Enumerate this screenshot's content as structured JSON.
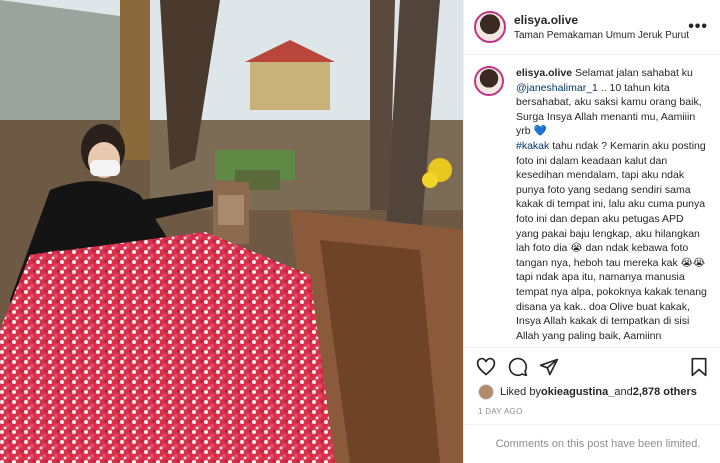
{
  "post": {
    "username": "elisya.olive",
    "location": "Taman Pemakaman Umum Jeruk Purut",
    "caption": {
      "username": "elisya.olive",
      "p1": " Selamat jalan sahabat ku ",
      "mention": "@janeshalimar_1",
      "p2": " .. 10 tahun kita bersahabat, aku saksi kamu orang baik, Surga Insya Allah menanti mu, Aamiiin yrb 💙\n",
      "hashtag": "#kakak",
      "p3": " tahu ndak ? Kemarin aku posting foto ini dalam keadaan kalut dan kesedihan mendalam, tapi aku ndak punya foto yang sedang sendiri sama kakak di tempat ini, lalu aku cuma punya foto ini dan depan aku petugas APD yang pakai baju lengkap, aku hilangkan lah foto dia 😭 dan ndak kebawa foto tangan nya, heboh tau mereka kak 😭😭 tapi ndak apa itu, namanya manusia tempat nya alpa, pokoknya kakak tenang disana ya kak.. doa Olive buat kakak, Insya Allah kakak di tempatkan di sisi Allah yang paling baik, Aamiinn"
    },
    "likes": {
      "prefix": "Liked by ",
      "user": "okieagustina_",
      "and": " and ",
      "others": "2,878 others"
    },
    "timestamp": "1 DAY AGO",
    "footer": "Comments on this post have been limited.",
    "icons": {
      "like": "heart-icon",
      "comment": "comment-icon",
      "share": "share-icon",
      "save": "bookmark-icon",
      "more": "more-options-icon"
    },
    "colors": {
      "avatar_ring": "#c13584",
      "link": "#00376b",
      "muted": "#8e8e8e"
    }
  }
}
